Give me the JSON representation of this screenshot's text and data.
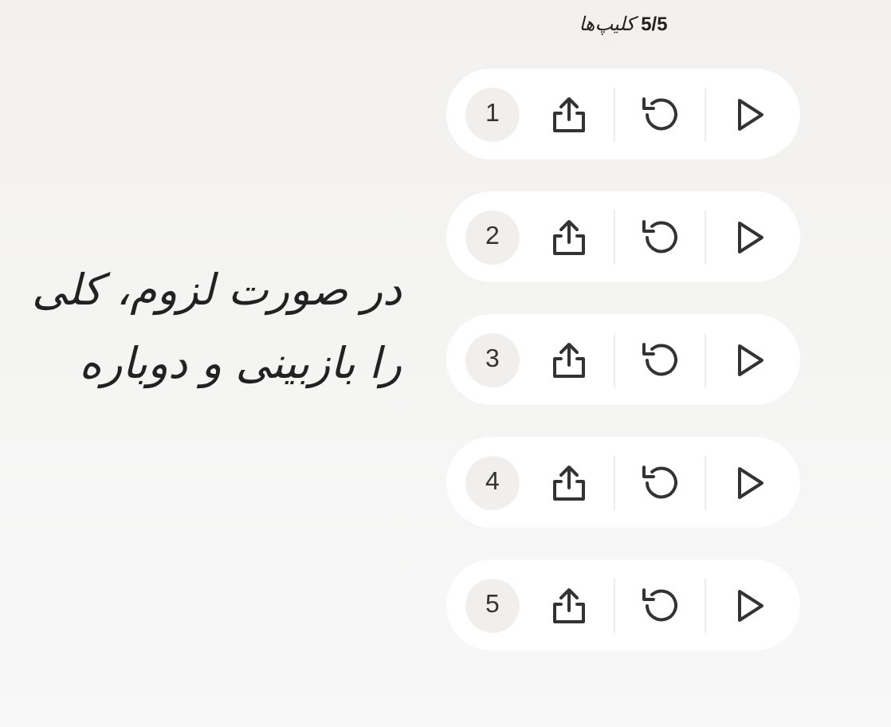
{
  "header": {
    "count": "5/5",
    "label": "کلیپ‌ها"
  },
  "message": {
    "lines": [
      "در صورت لزوم، کلی",
      "را بازبینی و دوباره"
    ]
  },
  "clips": [
    {
      "number": "1"
    },
    {
      "number": "2"
    },
    {
      "number": "3"
    },
    {
      "number": "4"
    },
    {
      "number": "5"
    }
  ]
}
